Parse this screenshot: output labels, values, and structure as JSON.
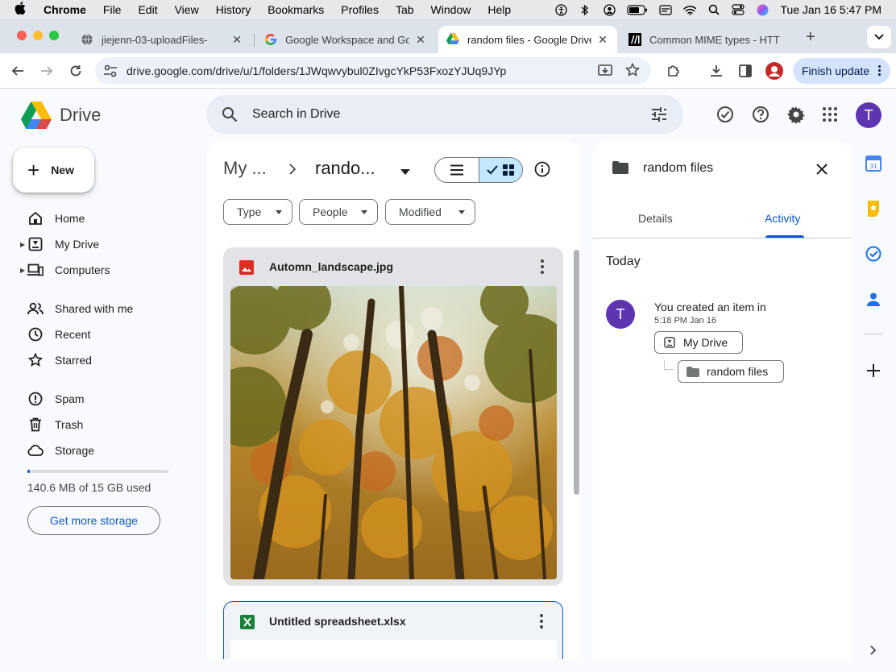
{
  "menubar": {
    "app": "Chrome",
    "items": [
      "File",
      "Edit",
      "View",
      "History",
      "Bookmarks",
      "Profiles",
      "Tab",
      "Window",
      "Help"
    ],
    "clock": "Tue Jan 16  5:47 PM"
  },
  "tabs": [
    {
      "title": "jiejenn-03-uploadFiles-",
      "favicon": "globe-icon"
    },
    {
      "title": "Google Workspace and Goo",
      "favicon": "google-g-icon"
    },
    {
      "title": "random files - Google Drive",
      "favicon": "drive-icon",
      "active": true
    },
    {
      "title": "Common MIME types - HTT",
      "favicon": "mdn-icon"
    }
  ],
  "toolbar": {
    "url": "drive.google.com/drive/u/1/folders/1JWqwvybul0ZIvgcYkP53FxozYJUq9JYp",
    "finish_update": "Finish update"
  },
  "drive": {
    "brand": "Drive",
    "search_placeholder": "Search in Drive",
    "avatar_letter": "T"
  },
  "nav": {
    "new_label": "New",
    "items": [
      {
        "label": "Home",
        "icon": "home-icon"
      },
      {
        "label": "My Drive",
        "icon": "my-drive-icon"
      },
      {
        "label": "Computers",
        "icon": "computers-icon"
      },
      {
        "label": "Shared with me",
        "icon": "shared-icon"
      },
      {
        "label": "Recent",
        "icon": "clock-icon"
      },
      {
        "label": "Starred",
        "icon": "star-icon"
      },
      {
        "label": "Spam",
        "icon": "spam-icon"
      },
      {
        "label": "Trash",
        "icon": "trash-icon"
      },
      {
        "label": "Storage",
        "icon": "cloud-icon"
      }
    ],
    "storage_used_fraction": 0.0094,
    "storage_text": "140.6 MB of 15 GB used",
    "get_more_storage": "Get more storage"
  },
  "main": {
    "breadcrumb_root": "My ...",
    "breadcrumb_current": "rando...",
    "filters": [
      "Type",
      "People",
      "Modified"
    ],
    "files": [
      {
        "name": "Automn_landscape.jpg",
        "type": "image"
      },
      {
        "name": "Untitled spreadsheet.xlsx",
        "type": "spreadsheet"
      }
    ]
  },
  "details": {
    "title": "random files",
    "tab_details": "Details",
    "tab_activity": "Activity",
    "today": "Today",
    "activity": {
      "avatar_letter": "T",
      "text": "You created an item in",
      "time": "5:18 PM Jan 16",
      "parent": "My Drive",
      "child": "random files"
    }
  },
  "colors": {
    "accent": "#0b57d0",
    "selected_toggle": "#c2e7ff",
    "avatar": "#5e35b1"
  }
}
